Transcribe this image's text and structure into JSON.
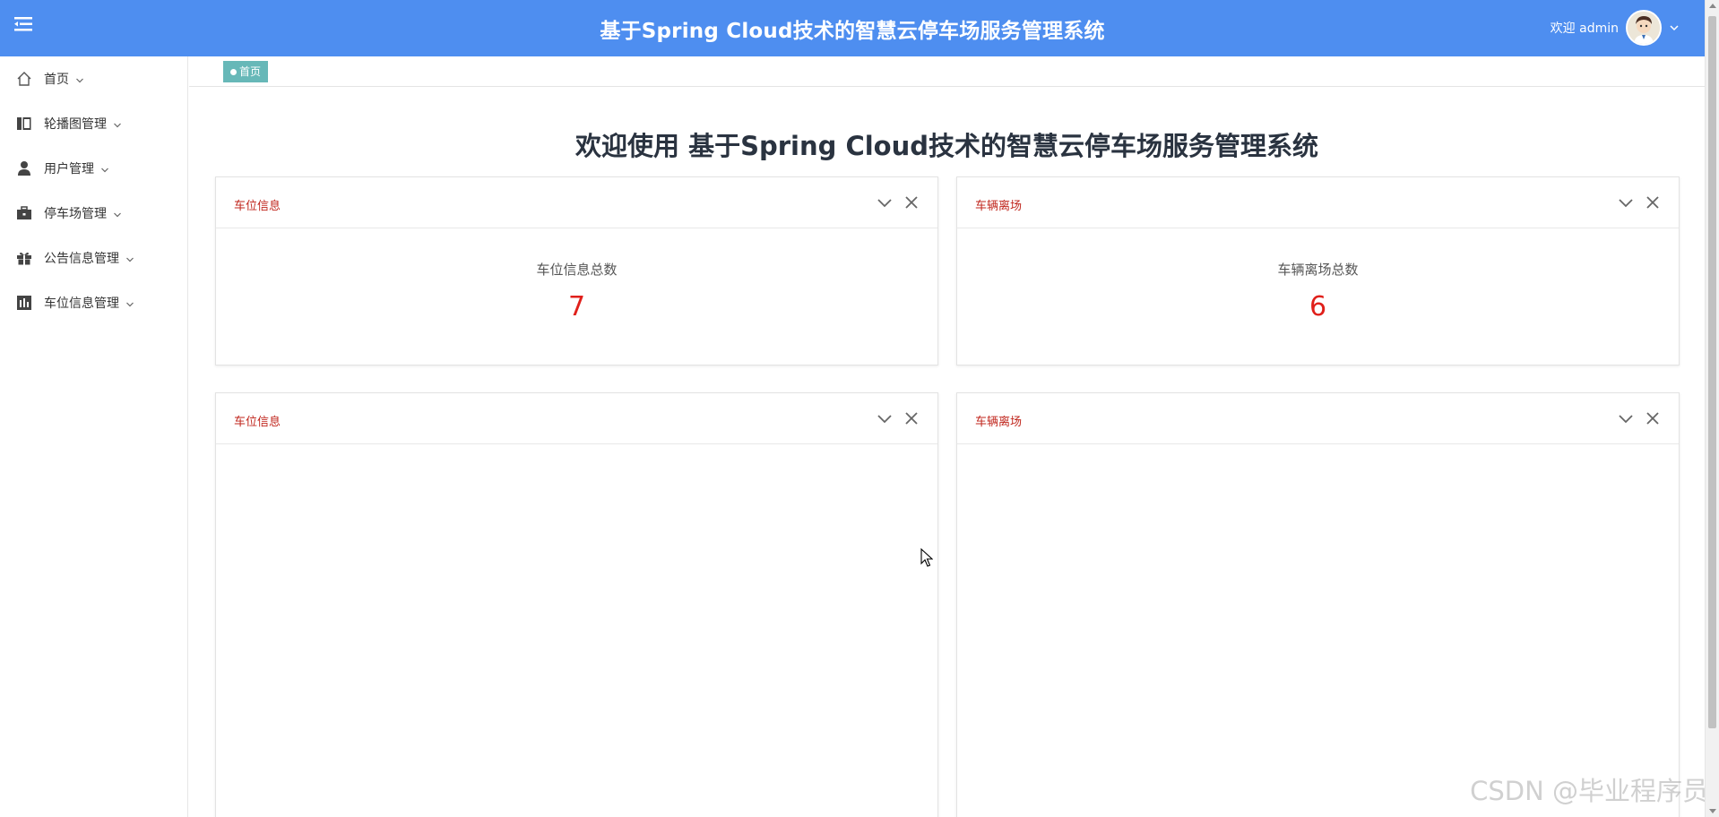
{
  "header": {
    "title": "基于Spring Cloud技术的智慧云停车场服务管理系统",
    "welcome_text": "欢迎 admin",
    "menu_icon": "hamburger-icon",
    "accent_color": "#4e8ef0"
  },
  "sidebar": {
    "items": [
      {
        "label": "首页",
        "icon": "home-icon"
      },
      {
        "label": "轮播图管理",
        "icon": "book-icon"
      },
      {
        "label": "用户管理",
        "icon": "user-icon"
      },
      {
        "label": "停车场管理",
        "icon": "briefcase-icon"
      },
      {
        "label": "公告信息管理",
        "icon": "gift-icon"
      },
      {
        "label": "车位信息管理",
        "icon": "chart-icon"
      }
    ]
  },
  "breadcrumb": {
    "label": "首页",
    "color": "#67b8b8"
  },
  "main": {
    "welcome_title": "欢迎使用 基于Spring Cloud技术的智慧云停车场服务管理系统",
    "stat_panels": [
      {
        "title": "车位信息",
        "label": "车位信息总数",
        "value": "7"
      },
      {
        "title": "车辆离场",
        "label": "车辆离场总数",
        "value": "6"
      }
    ],
    "chart_panels": [
      {
        "title": "车位信息"
      },
      {
        "title": "车辆离场"
      }
    ]
  },
  "watermark": "CSDN @毕业程序员",
  "colors": {
    "panel_title": "#c0261d",
    "stat_value": "#e0201b"
  }
}
